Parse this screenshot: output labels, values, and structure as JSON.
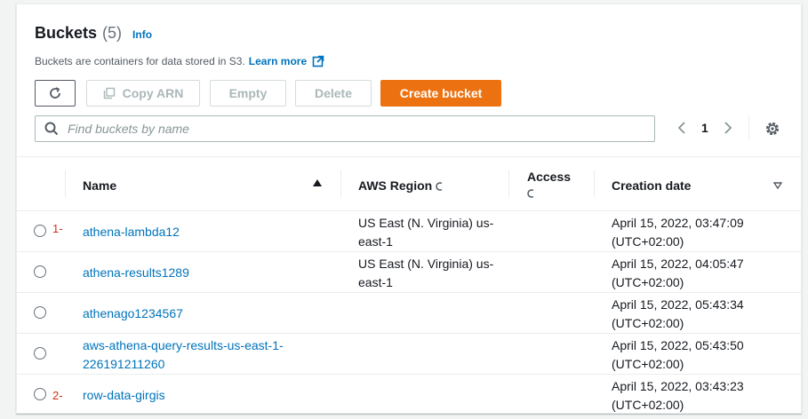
{
  "header": {
    "title": "Buckets",
    "count": "(5)",
    "info": "Info",
    "description": "Buckets are containers for data stored in S3.",
    "learn_more": "Learn more"
  },
  "toolbar": {
    "copy_arn": "Copy ARN",
    "empty": "Empty",
    "delete": "Delete",
    "create": "Create bucket"
  },
  "search": {
    "placeholder": "Find buckets by name"
  },
  "pagination": {
    "page": "1"
  },
  "columns": {
    "name": "Name",
    "region": "AWS Region",
    "access": "Access",
    "creation": "Creation date"
  },
  "rows": [
    {
      "annotation": "1-",
      "name": "athena-lambda12",
      "region_line1": "US East (N. Virginia) us-",
      "region_line2": "east-1",
      "date_line1": "April 15, 2022, 03:47:09",
      "date_line2": "(UTC+02:00)"
    },
    {
      "annotation": "",
      "name": "athena-results1289",
      "region_line1": "US East (N. Virginia) us-",
      "region_line2": "east-1",
      "date_line1": "April 15, 2022, 04:05:47",
      "date_line2": "(UTC+02:00)"
    },
    {
      "annotation": "",
      "name": "athenago1234567",
      "region_line1": "",
      "region_line2": "",
      "date_line1": "April 15, 2022, 05:43:34",
      "date_line2": "(UTC+02:00)"
    },
    {
      "annotation": "",
      "name_line1": "aws-athena-query-results-us-east-1-",
      "name_line2": "226191211260",
      "region_line1": "",
      "region_line2": "",
      "date_line1": "April 15, 2022, 05:43:50",
      "date_line2": "(UTC+02:00)"
    },
    {
      "annotation": "2-",
      "name": "row-data-girgis",
      "region_line1": "",
      "region_line2": "",
      "date_line1": "April 15, 2022, 03:43:23",
      "date_line2": "(UTC+02:00)"
    }
  ],
  "colors": {
    "accent": "#ec7211",
    "link": "#0073bb",
    "annotation": "#d13212"
  }
}
